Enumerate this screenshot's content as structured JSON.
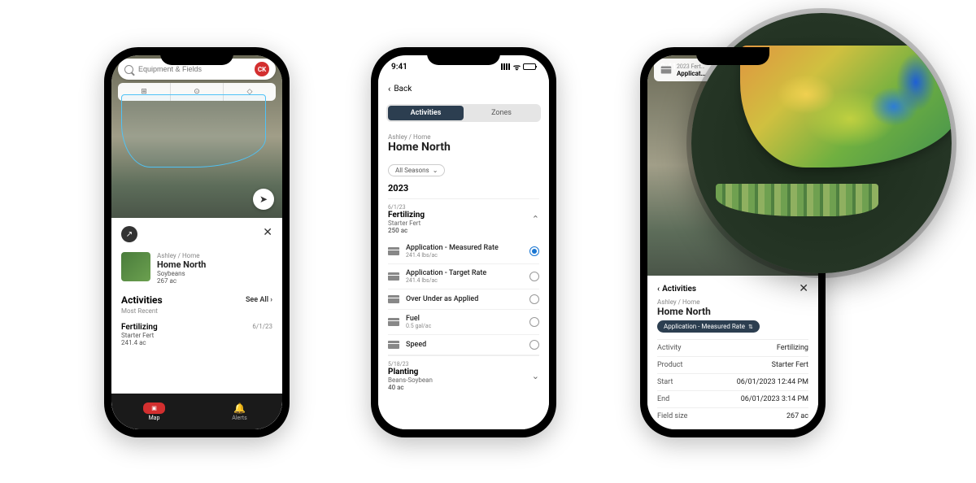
{
  "status": {
    "time": "9:41"
  },
  "p1": {
    "search_placeholder": "Equipment & Fields",
    "avatar": "CK",
    "breadcrumb": "Ashley / Home",
    "field_name": "Home North",
    "crop": "Soybeans",
    "area": "267 ac",
    "activities_title": "Activities",
    "see_all": "See All",
    "most_recent": "Most Recent",
    "activity": {
      "name": "Fertilizing",
      "date": "6/1/23",
      "product": "Starter Fert",
      "amount": "241.4 ac"
    },
    "nav": {
      "map": "Map",
      "alerts": "Alerts"
    }
  },
  "p2": {
    "back": "Back",
    "tabs": {
      "activities": "Activities",
      "zones": "Zones"
    },
    "breadcrumb": "Ashley / Home",
    "field_name": "Home North",
    "season_filter": "All Seasons",
    "year": "2023",
    "group1": {
      "date": "6/1/23",
      "title": "Fertilizing",
      "product": "Starter Fert",
      "area": "250 ac"
    },
    "opts": [
      {
        "title": "Application - Measured Rate",
        "sub": "241.4 lbs/ac",
        "selected": true
      },
      {
        "title": "Application - Target Rate",
        "sub": "241.4 lbs/ac",
        "selected": false
      },
      {
        "title": "Over Under as Applied",
        "sub": "",
        "selected": false
      },
      {
        "title": "Fuel",
        "sub": "0.5 gal/ac",
        "selected": false
      },
      {
        "title": "Speed",
        "sub": "",
        "selected": false
      }
    ],
    "group2": {
      "date": "5/18/23",
      "title": "Planting",
      "product": "Beans-Soybean",
      "area": "40 ac"
    }
  },
  "p3": {
    "header_sub": "2023 Fert…",
    "header_title": "Applicat…",
    "nav_back": "Activities",
    "breadcrumb": "Ashley / Home",
    "field_name": "Home North",
    "chip": "Application - Measured Rate",
    "rows": {
      "activity_k": "Activity",
      "activity_v": "Fertilizing",
      "product_k": "Product",
      "product_v": "Starter Fert",
      "start_k": "Start",
      "start_v": "06/01/2023 12:44 PM",
      "end_k": "End",
      "end_v": "06/01/2023 3:14 PM",
      "size_k": "Field size",
      "size_v": "267 ac"
    }
  }
}
